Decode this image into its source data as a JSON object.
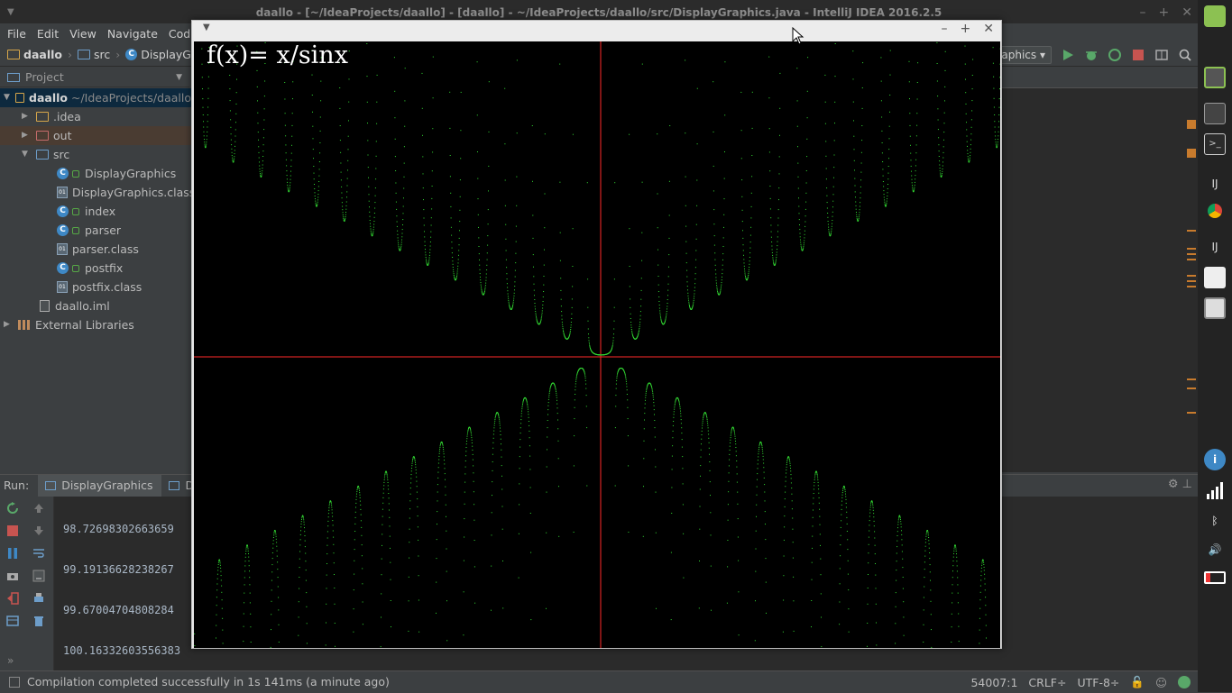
{
  "window": {
    "title": "daallo - [~/IdeaProjects/daallo] - [daallo] - ~/IdeaProjects/daallo/src/DisplayGraphics.java - IntelliJ IDEA 2016.2.5"
  },
  "menu": [
    "File",
    "Edit",
    "View",
    "Navigate",
    "Code"
  ],
  "breadcrumbs": [
    "daallo",
    "src",
    "DisplayGrap"
  ],
  "run_config": "aphics",
  "project_panel": {
    "title": "Project",
    "tree": [
      {
        "label": "daallo",
        "extra": "~/IdeaProjects/daallo",
        "kind": "folder"
      },
      {
        "label": ".idea",
        "kind": "folder"
      },
      {
        "label": "out",
        "kind": "folder-excluded"
      },
      {
        "label": "src",
        "kind": "folder-source"
      },
      {
        "label": "DisplayGraphics",
        "kind": "class"
      },
      {
        "label": "DisplayGraphics.class",
        "kind": "classfile"
      },
      {
        "label": "index",
        "kind": "class"
      },
      {
        "label": "parser",
        "kind": "class"
      },
      {
        "label": "parser.class",
        "kind": "classfile"
      },
      {
        "label": "postfix",
        "kind": "class"
      },
      {
        "label": "postfix.class",
        "kind": "classfile"
      },
      {
        "label": "daallo.iml",
        "kind": "iml"
      },
      {
        "label": "External Libraries",
        "kind": "libraries"
      }
    ]
  },
  "run_panel": {
    "label": "Run:",
    "tabs": [
      "DisplayGraphics",
      "Displ"
    ],
    "console_lines": [
      "98.72698302663659",
      "99.19136628238267",
      "99.67004704808284",
      "100.16332603556383"
    ]
  },
  "status": {
    "message": "Compilation completed successfully in 1s 141ms (a minute ago)",
    "position": "54007:1",
    "line_sep": "CRLF÷",
    "encoding": "UTF-8÷"
  },
  "graph_window": {
    "formula": "f(x)= x/sinx"
  },
  "chart_data": {
    "type": "scatter",
    "title": "f(x)= x/sinx",
    "function": "x/sin(x)",
    "colors": {
      "curve": "#33dd33",
      "axes": "#ff2a2a",
      "background": "#000000"
    },
    "xlabel": "",
    "ylabel": "",
    "grid": false
  }
}
